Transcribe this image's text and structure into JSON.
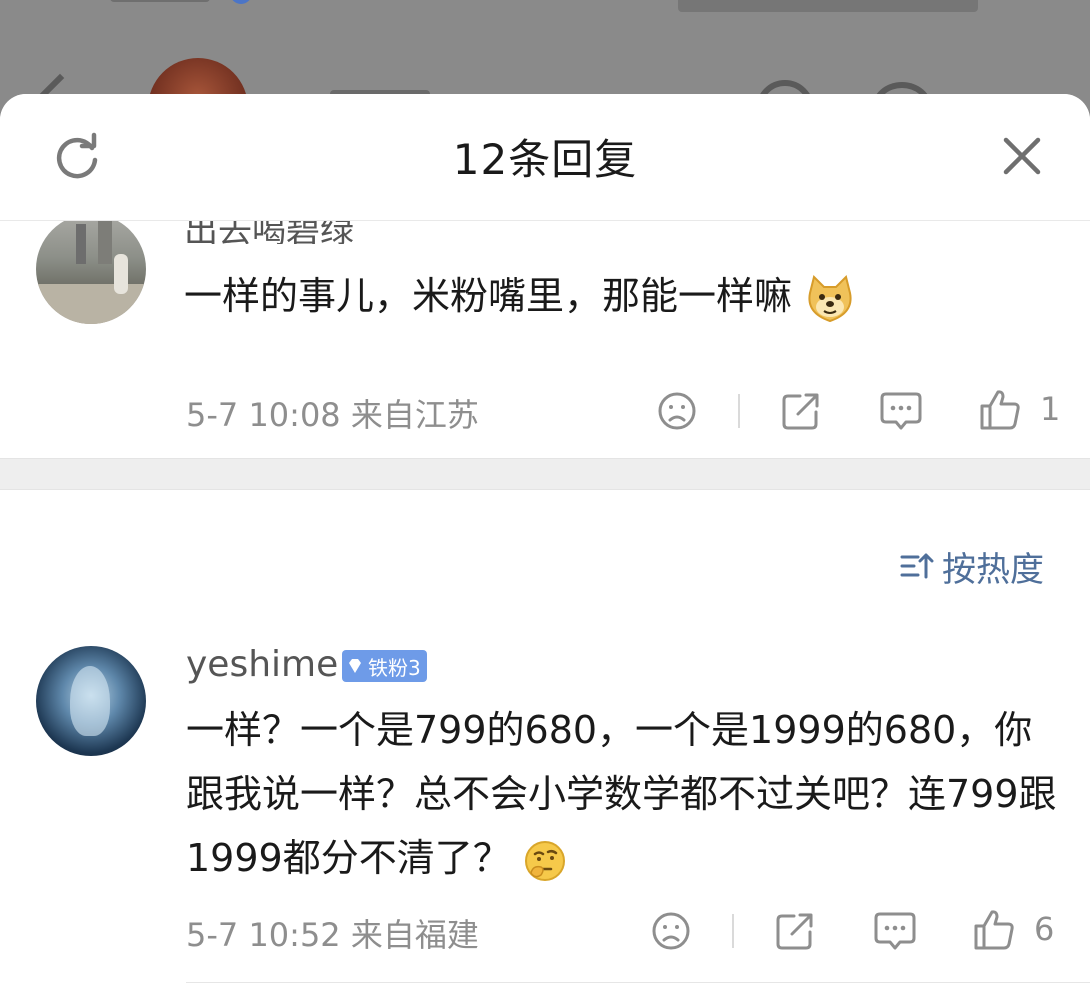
{
  "sheet": {
    "title": "12条回复"
  },
  "comments": [
    {
      "name": "出去喝碧绿",
      "text": "一样的事儿，米粉嘴里，那能一样嘛",
      "meta": "5-7 10:08  来自江苏",
      "likes": "1"
    },
    {
      "name": "yeshime",
      "badge": "铁粉3",
      "text": "一样？一个是799的680，一个是1999的680，你跟我说一样？总不会小学数学都不过关吧？连799跟1999都分不清了？",
      "meta": "5-7 10:52  来自福建",
      "likes": "6"
    }
  ],
  "sort": {
    "label": "按热度"
  },
  "colors": {
    "accent": "#4f6f9a",
    "meta_gray": "#8e8e8e",
    "badge_blue": "#6e9be8"
  },
  "icons": [
    "refresh-icon",
    "close-icon",
    "dislike-icon",
    "share-icon",
    "comment-icon",
    "like-icon",
    "sort-icon"
  ]
}
